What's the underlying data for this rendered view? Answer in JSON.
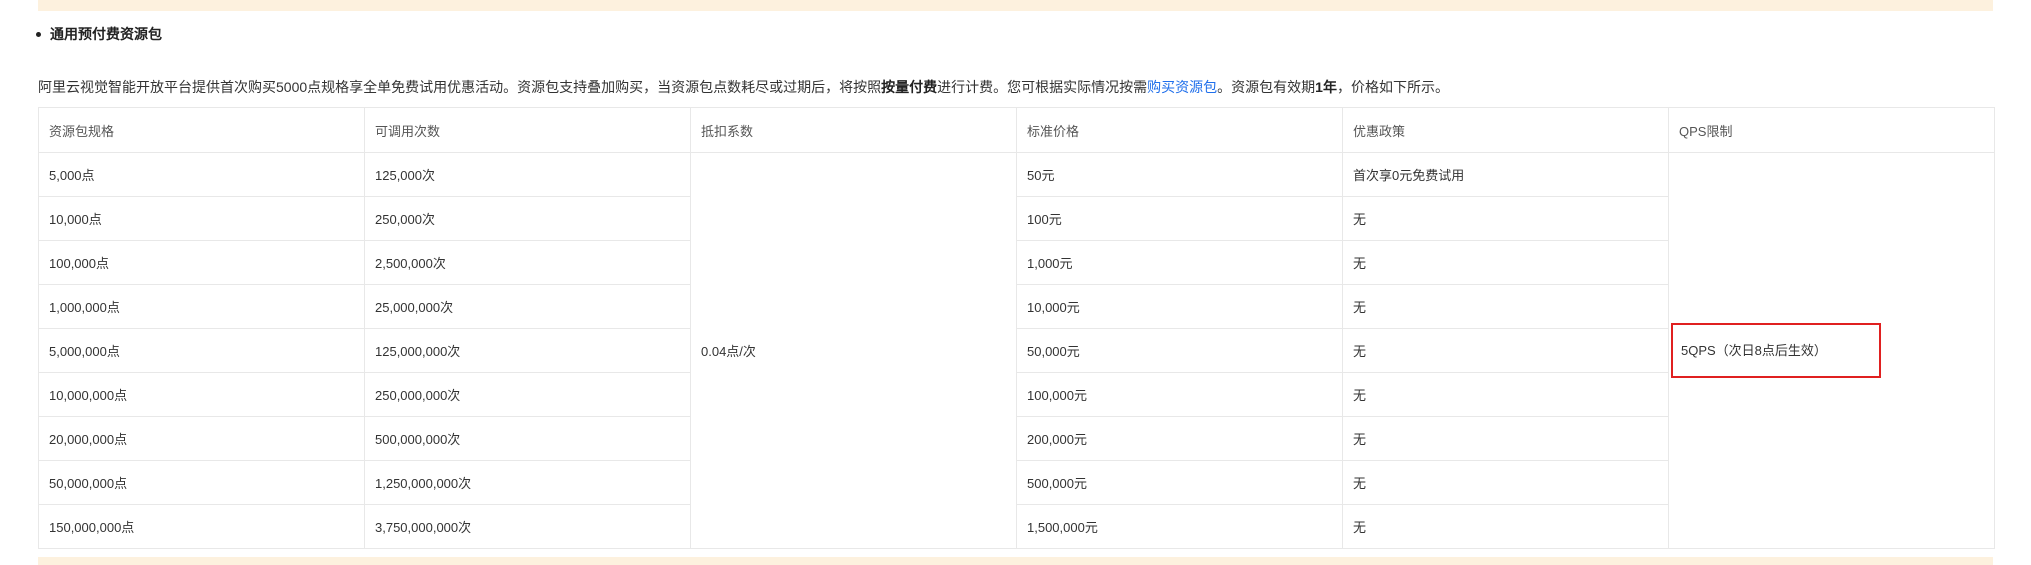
{
  "section_title": "通用预付费资源包",
  "intro": {
    "part1": "阿里云视觉智能开放平台提供首次购买5000点规格享全单免费试用优惠活动。资源包支持叠加购买，当资源包点数耗尽或过期后，将按照",
    "bold1": "按量付费",
    "part2": "进行计费。您可根据实际情况按需",
    "link": "购买资源包",
    "part3": "。资源包有效期",
    "bold2": "1年",
    "part4": "，价格如下所示。"
  },
  "table": {
    "headers": [
      "资源包规格",
      "可调用次数",
      "抵扣系数",
      "标准价格",
      "优惠政策",
      "QPS限制"
    ],
    "deduction": "0.04点/次",
    "qps": "5QPS（次日8点后生效）",
    "rows": [
      {
        "spec": "5,000点",
        "calls": "125,000次",
        "price": "50元",
        "policy": "首次享0元免费试用"
      },
      {
        "spec": "10,000点",
        "calls": "250,000次",
        "price": "100元",
        "policy": "无"
      },
      {
        "spec": "100,000点",
        "calls": "2,500,000次",
        "price": "1,000元",
        "policy": "无"
      },
      {
        "spec": "1,000,000点",
        "calls": "25,000,000次",
        "price": "10,000元",
        "policy": "无"
      },
      {
        "spec": "5,000,000点",
        "calls": "125,000,000次",
        "price": "50,000元",
        "policy": "无"
      },
      {
        "spec": "10,000,000点",
        "calls": "250,000,000次",
        "price": "100,000元",
        "policy": "无"
      },
      {
        "spec": "20,000,000点",
        "calls": "500,000,000次",
        "price": "200,000元",
        "policy": "无"
      },
      {
        "spec": "50,000,000点",
        "calls": "1,250,000,000次",
        "price": "500,000元",
        "policy": "无"
      },
      {
        "spec": "150,000,000点",
        "calls": "3,750,000,000次",
        "price": "1,500,000元",
        "policy": "无"
      }
    ]
  },
  "colors": {
    "highlight_border": "#e02020",
    "link": "#1f6feb",
    "banner": "#fdf1de"
  }
}
